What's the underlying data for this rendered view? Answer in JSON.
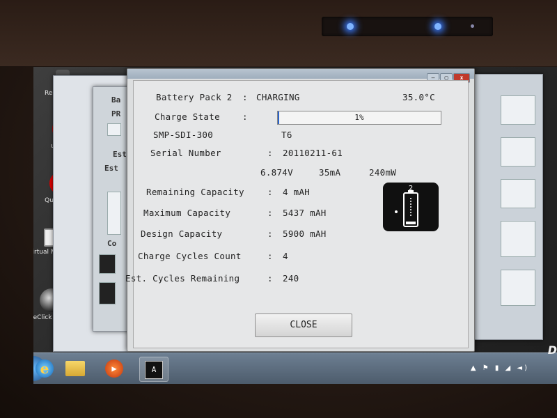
{
  "desktop": {
    "icons": [
      {
        "label": "Recycle Bin"
      },
      {
        "label": "u-center",
        "glyph": "u"
      },
      {
        "label": "QuickMark",
        "glyph": "Q"
      },
      {
        "label": "Virtual Magnifyi..."
      },
      {
        "label": "OneClick Internet"
      }
    ]
  },
  "background_windows": {
    "labels": [
      "Ba",
      "PR",
      "Est",
      "Est",
      "Co"
    ]
  },
  "dialog": {
    "title": "Battery Pack 2",
    "title_sep": ":",
    "status": "CHARGING",
    "temperature": "35.0°C",
    "charge_state_label": "Charge State",
    "charge_state_percent": 1,
    "charge_state_text": "1%",
    "model": "SMP-SDI-300",
    "model_code": "T6",
    "serial_label": "Serial Number",
    "serial_value": "20110211-61",
    "voltage": "6.874V",
    "current": "35mA",
    "power": "240mW",
    "remaining_label": "Remaining Capacity",
    "remaining_value": "4 mAH",
    "max_label": "Maximum Capacity",
    "max_value": "5437 mAH",
    "design_label": "Design Capacity",
    "design_value": "5900 mAH",
    "cycles_label": "Charge Cycles Count",
    "cycles_value": "4",
    "est_label": "Est. Cycles Remaining",
    "est_value": "240",
    "battery_icon_number": "2",
    "close_label": "CLOSE",
    "colon": ":"
  },
  "taskbar": {
    "app_glyph": "A",
    "ie_glyph": "e",
    "brand": "D"
  },
  "colors": {
    "charge_fill": "#2a62c9",
    "led": "#7fb4ff",
    "close_control": "#c0392b"
  }
}
